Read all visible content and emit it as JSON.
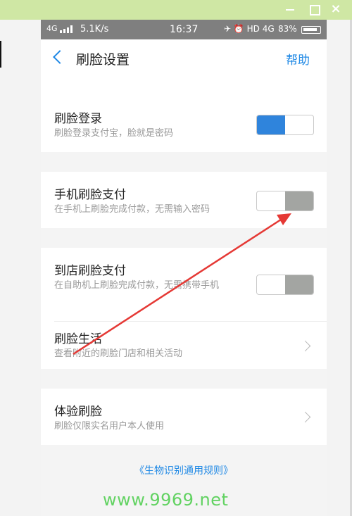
{
  "status_bar": {
    "network": "4G",
    "speed": "5.1K/s",
    "time": "16:37",
    "right_icons": "✈ ⏰ HD 4G",
    "battery": "83%"
  },
  "nav": {
    "back_icon": "chevron-left-icon",
    "title": "刷脸设置",
    "help": "帮助"
  },
  "settings": {
    "face_login": {
      "title": "刷脸登录",
      "subtitle": "刷脸登录支付宝，脸就是密码",
      "enabled": true
    },
    "phone_face_pay": {
      "title": "手机刷脸支付",
      "subtitle": "在手机上刷脸完成付款，无需输入密码",
      "enabled": false
    },
    "store_face_pay": {
      "title": "到店刷脸支付",
      "subtitle": "在自助机上刷脸完成付款，无需携带手机",
      "enabled": false
    },
    "face_life": {
      "title": "刷脸生活",
      "subtitle": "查看附近的刷脸门店和相关活动"
    },
    "try_face": {
      "title": "体验刷脸",
      "subtitle": "刷脸仅限实名用户本人使用"
    }
  },
  "footer": {
    "rules_link": "《生物识别通用规则》"
  },
  "watermark": "www.9969.net",
  "colors": {
    "accent": "#1e88e5",
    "toggle_on": "#2f84dc",
    "toggle_off": "#a3a5a2",
    "annotation_arrow": "#e53935"
  }
}
